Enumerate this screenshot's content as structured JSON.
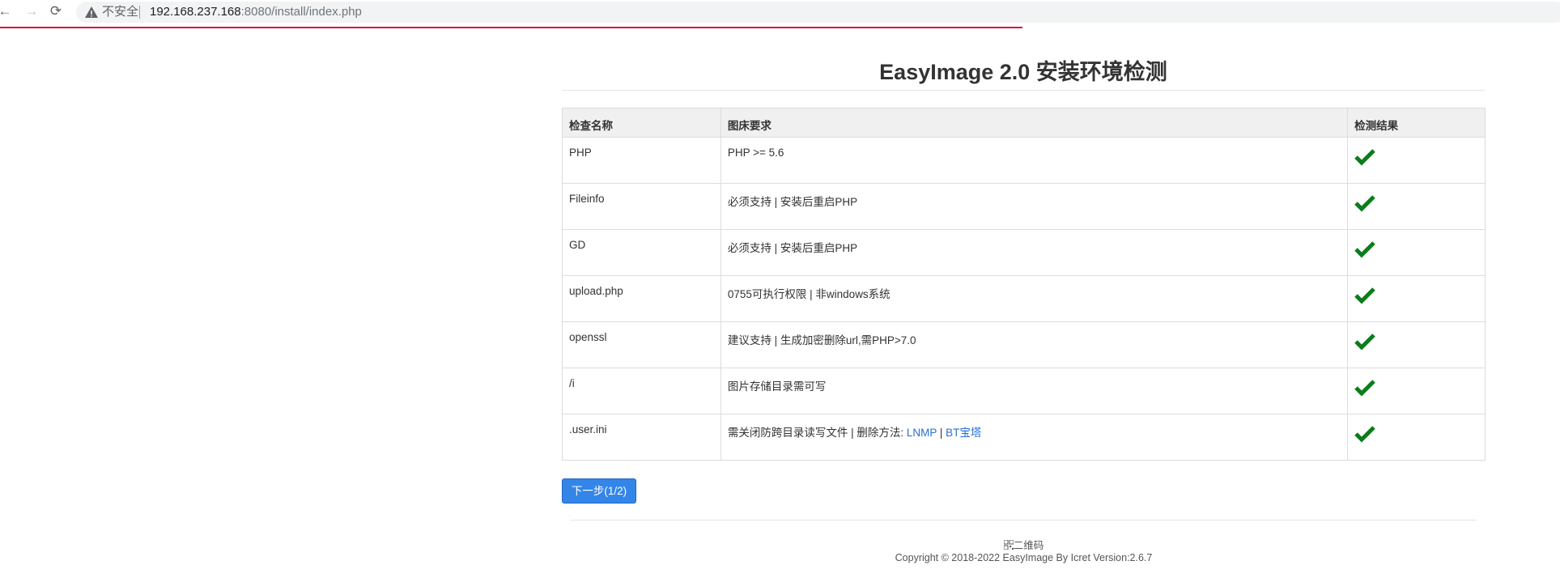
{
  "browser": {
    "security_label": "不安全",
    "url_host": "192.168.237.168",
    "url_rest": ":8080/install/index.php"
  },
  "page": {
    "title": "EasyImage 2.0 安装环境检测"
  },
  "table": {
    "headers": [
      "检查名称",
      "图床要求",
      "检测结果"
    ],
    "rows": [
      {
        "name": "PHP",
        "requirement": "PHP >= 5.6",
        "result": "check-icon"
      },
      {
        "name": "Fileinfo",
        "requirement": "必须支持 | 安装后重启PHP",
        "result": "check-icon"
      },
      {
        "name": "GD",
        "requirement": "必须支持 | 安装后重启PHP",
        "result": "check-icon"
      },
      {
        "name": "upload.php",
        "requirement": "0755可执行权限 | 非windows系统",
        "result": "check-icon"
      },
      {
        "name": "openssl",
        "requirement": "建议支持 | 生成加密删除url,需PHP>7.0",
        "result": "check-icon"
      },
      {
        "name": "/i",
        "requirement": "图片存储目录需可写",
        "result": "check-icon"
      },
      {
        "name": ".user.ini",
        "requirement": "需关闭防跨目录读写文件 | 删除方法: ",
        "link1": "LNMP",
        "separator": " | ",
        "link2": "BT宝塔",
        "result": "check-icon"
      }
    ]
  },
  "actions": {
    "next_label": "下一步(1/2)"
  },
  "footer": {
    "qr_label": "二维码",
    "copyright": "Copyright © 2018-2022 EasyImage By Icret Version:2.6.7"
  },
  "colors": {
    "check": "#0a7d1b",
    "link": "#2a6fd6",
    "button": "#3386e8",
    "load_bar": "#d01842"
  }
}
